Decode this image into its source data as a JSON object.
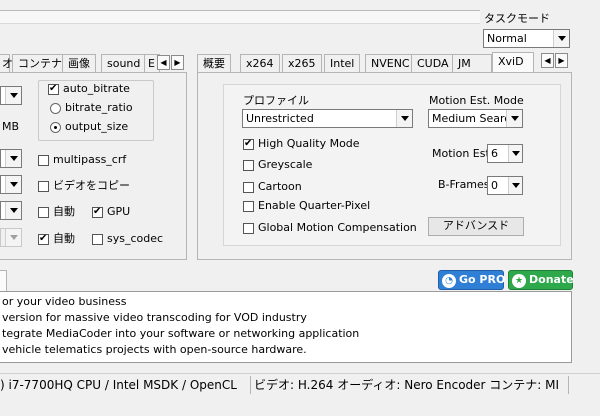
{
  "task_mode": {
    "label": "タスクモード",
    "value": "Normal"
  },
  "left_tabs": [
    "オ",
    "コンテナ",
    "画像",
    "sound",
    "E"
  ],
  "right_tabs": [
    "概要",
    "x264",
    "x265",
    "Intel",
    "NVENC",
    "CUDA",
    "JM",
    "XviD"
  ],
  "left_panel": {
    "bitrate_mode": {
      "auto_bitrate": "auto_bitrate",
      "bitrate_ratio": "bitrate_ratio",
      "output_size": "output_size"
    },
    "mb_label": "MB",
    "multipass_crf": "multipass_crf",
    "video_copy": "ビデオをコピー",
    "auto1": "自動",
    "gpu": "GPU",
    "auto2": "自動",
    "sys_codec": "sys_codec"
  },
  "xvid": {
    "profile_label": "プロファイル",
    "profile_value": "Unrestricted",
    "motion_mode_label": "Motion Est. Mode",
    "motion_mode_value": "Medium Search",
    "high_quality": "High Quality Mode",
    "greyscale": "Greyscale",
    "cartoon": "Cartoon",
    "quarter_pixel": "Enable Quarter-Pixel",
    "gmc": "Global Motion Compensation",
    "motion_est_label": "Motion Est.",
    "motion_est_value": "6",
    "bframes_label": "B-Frames",
    "bframes_value": "0",
    "advanced_button": "アドバンスド"
  },
  "promo": {
    "go_pro": "Go PRO",
    "donate": "Donate"
  },
  "news": [
    "or your video business",
    " version for massive video transcoding for VOD industry",
    "tegrate MediaCoder into your software or networking application",
    "vehicle telematics projects with open-source hardware."
  ],
  "status": {
    "hardware": ") i7-7700HQ CPU  / Intel MSDK / OpenCL",
    "summary": "ビデオ: H.264  オーディオ: Nero Encoder  コンテナ: MI"
  }
}
